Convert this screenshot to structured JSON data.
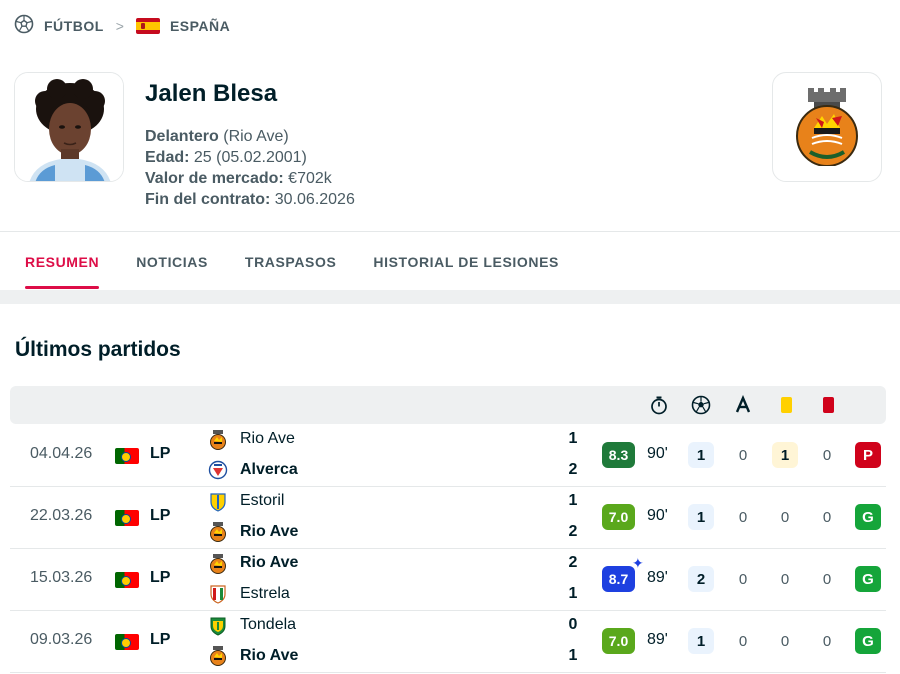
{
  "breadcrumb": {
    "sport": "FÚTBOL",
    "country": "ESPAÑA"
  },
  "player": {
    "name": "Jalen Blesa",
    "position_label": "Delantero",
    "position_value": " (Rio Ave)",
    "age_label": "Edad:",
    "age_value": " 25 (05.02.2001)",
    "market_label": "Valor de mercado:",
    "market_value": " €702k",
    "contract_label": "Fin del contrato:",
    "contract_value": " 30.06.2026"
  },
  "tabs": [
    {
      "label": "RESUMEN",
      "active": true
    },
    {
      "label": "NOTICIAS",
      "active": false
    },
    {
      "label": "TRASPASOS",
      "active": false
    },
    {
      "label": "HISTORIAL DE LESIONES",
      "active": false
    }
  ],
  "section_title": "Últimos partidos",
  "columns": [
    "stopwatch-icon",
    "ball-icon",
    "assist-icon",
    "yellow-card-icon",
    "red-card-icon"
  ],
  "colors": {
    "accent": "#dd0d47",
    "rating_dark_green": "#1f7a3a",
    "rating_light_green": "#5aa81c",
    "rating_blue": "#1e40e0",
    "win": "#15a53a",
    "loss": "#d0021b"
  },
  "matches": [
    {
      "date": "04.04.26",
      "league": "LP",
      "home": "Rio Ave",
      "away": "Alverca",
      "home_score": "1",
      "away_score": "2",
      "winner": "away",
      "rating": "8.3",
      "rating_color": "#1f7a3a",
      "star": false,
      "minutes": "90'",
      "goals": "1",
      "assists": "0",
      "yellow": "1",
      "red": "0",
      "result": "P",
      "home_logo": "rio-ave",
      "away_logo": "alverca"
    },
    {
      "date": "22.03.26",
      "league": "LP",
      "home": "Estoril",
      "away": "Rio Ave",
      "home_score": "1",
      "away_score": "2",
      "winner": "away",
      "rating": "7.0",
      "rating_color": "#5aa81c",
      "star": false,
      "minutes": "90'",
      "goals": "1",
      "assists": "0",
      "yellow": "0",
      "red": "0",
      "result": "G",
      "home_logo": "estoril",
      "away_logo": "rio-ave"
    },
    {
      "date": "15.03.26",
      "league": "LP",
      "home": "Rio Ave",
      "away": "Estrela",
      "home_score": "2",
      "away_score": "1",
      "winner": "home",
      "rating": "8.7",
      "rating_color": "#1e40e0",
      "star": true,
      "minutes": "89'",
      "goals": "2",
      "assists": "0",
      "yellow": "0",
      "red": "0",
      "result": "G",
      "home_logo": "rio-ave",
      "away_logo": "estrela"
    },
    {
      "date": "09.03.26",
      "league": "LP",
      "home": "Tondela",
      "away": "Rio Ave",
      "home_score": "0",
      "away_score": "1",
      "winner": "away",
      "rating": "7.0",
      "rating_color": "#5aa81c",
      "star": false,
      "minutes": "89'",
      "goals": "1",
      "assists": "0",
      "yellow": "0",
      "red": "0",
      "result": "G",
      "home_logo": "tondela",
      "away_logo": "rio-ave"
    }
  ]
}
